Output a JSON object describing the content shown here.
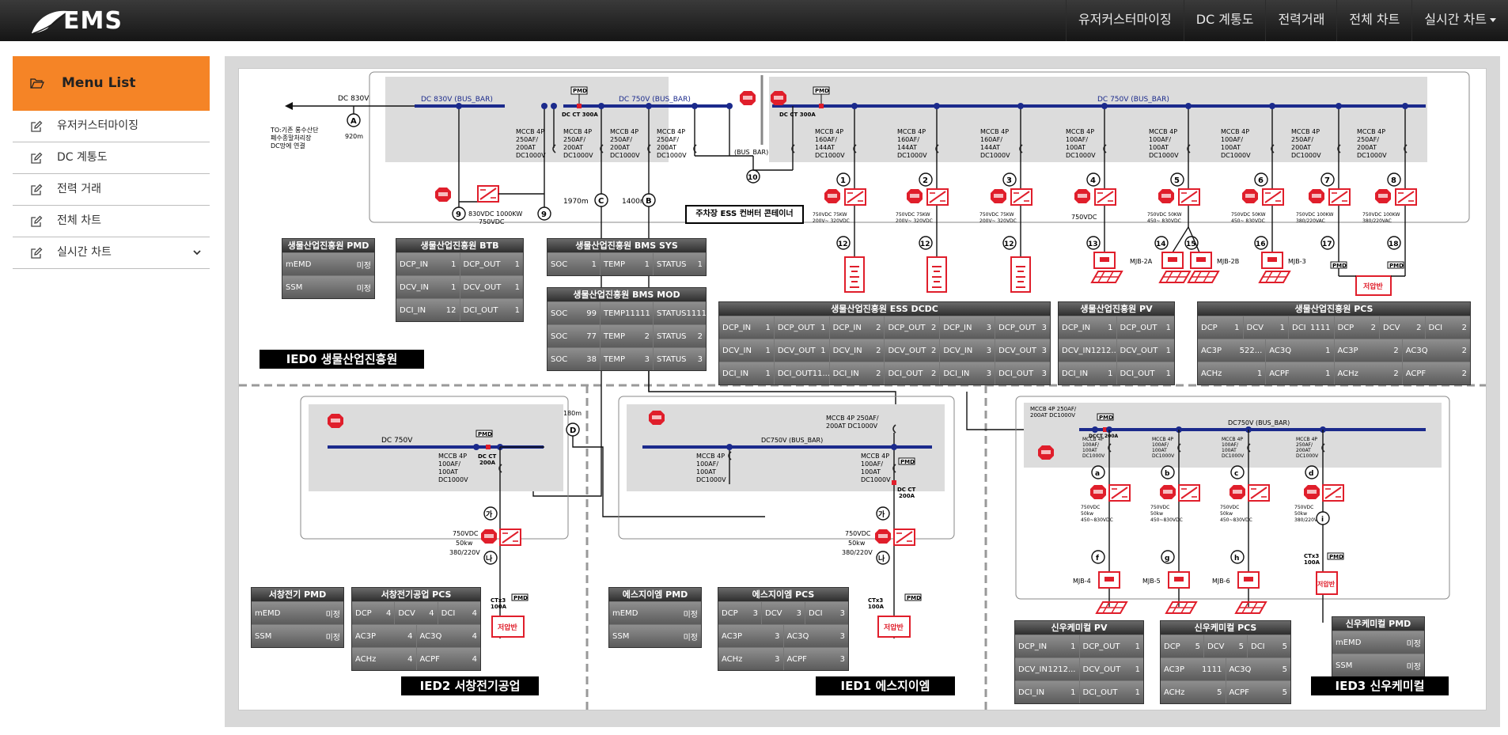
{
  "brand": {
    "logo_text": "EMS"
  },
  "nav": [
    {
      "label": "유저커스터마이징"
    },
    {
      "label": "DC 계통도"
    },
    {
      "label": "전력거래"
    },
    {
      "label": "전체 차트"
    },
    {
      "label": "실시간 차트"
    }
  ],
  "sidebar": {
    "title": "Menu List",
    "items": [
      {
        "label": "유저커스터마이징"
      },
      {
        "label": "DC 계통도"
      },
      {
        "label": "전력 거래"
      },
      {
        "label": "전체 차트"
      },
      {
        "label": "실시간 차트"
      }
    ]
  },
  "colors": {
    "accent": "#f58426",
    "bus": "#1b2a8c",
    "alarm": "#e01e2b",
    "header_bg": "#1f1f1f"
  },
  "diagram": {
    "ied_labels": {
      "ied0": "IED0 생물산업진흥원",
      "ied1": "IED1 에스지이엠",
      "ied2": "IED2 서창전기공업",
      "ied3": "IED3 신우케미컬"
    },
    "ess_box": "주차장 ESS 컨버터 콘테이너",
    "labels": {
      "dc830v": "DC 830V",
      "bus830": "DC 830V (BUS_BAR)",
      "bus750a": "DC 750V (BUS_BAR)",
      "bus750b": "DC 750V (BUS_BAR)",
      "busbar": "(BUS_BAR)",
      "to_line1": "TO:기존 롱수산단",
      "to_line2": "폐수종말처리장",
      "to_line3": "DC망에 연결",
      "dist920": "920m",
      "dist1970": "1970m",
      "dist1400": "1400m",
      "dist180": "180m",
      "conv_btb1": "830VDC 1000KW",
      "conv_btb2": "750VDC",
      "pmd": "PMD",
      "dcct300": "DC CT 300A",
      "dc750_ied2": "DC 750V",
      "dc750_ied1": "DC750V (BUS_BAR)",
      "dc750_ied3": "DC750V (BUS_BAR)",
      "mccb_top_ied1_1": "MCCB 4P 250AF/",
      "mccb_top_ied1_2": "200AT DC1000V",
      "mccb_top_ied3_1": "MCCB 4P 250AF/",
      "mccb_top_ied3_2": "200AT DC1000V",
      "dcct200": "DC CT 200A",
      "dcct200b": "DCCT 200A",
      "ctx3": "CTx3",
      "ct100a": "100A",
      "jeoneap": "저압반",
      "mjb2a": "MJB-2A",
      "mjb2b": "MJB-2B",
      "mjb3": "MJB-3",
      "mjb4": "MJB-4",
      "mjb5": "MJB-5",
      "mjb6": "MJB-6",
      "ied_conv_v": "750VDC",
      "ied_conv_kw": "50kw",
      "ied_conv_ac": "380/220V",
      "ied3_conv1": "750VDC",
      "ied3_conv2": "50kw",
      "ied3_conv3": "450~830VDC",
      "ied3_conv4": "380/220VAC",
      "ess_conv1": "750VDC 75KW",
      "ess_conv2": "200V~ 320VDC",
      "pv_conv": "750VDC",
      "pv_conv1": "750VDC 50KW",
      "pv_conv2": "450~ 830VDC",
      "pcs_conv1": "750VDC 100KW",
      "pcs_conv2": "380/220VAC"
    },
    "mccb_top": [
      [
        "MCCB 4P",
        "250AF/",
        "200AT",
        "DC1000V"
      ],
      [
        "MCCB 4P",
        "250AF/",
        "200AT",
        "DC1000V"
      ],
      [
        "MCCB 4P",
        "250AF/",
        "200AT",
        "DC1000V"
      ],
      [
        "MCCB 4P",
        "250AF/",
        "200AT",
        "DC1000V"
      ]
    ],
    "mccb_right": [
      [
        "MCCB 4P",
        "160AF/",
        "144AT",
        "DC1000V"
      ],
      [
        "MCCB 4P",
        "160AF/",
        "144AT",
        "DC1000V"
      ],
      [
        "MCCB 4P",
        "160AF/",
        "144AT",
        "DC1000V"
      ],
      [
        "MCCB 4P",
        "160AF/",
        "144AT",
        "DC1000V"
      ],
      [
        "MCCB 4P",
        "100AF/",
        "100AT",
        "DC1000V"
      ],
      [
        "MCCB 4P",
        "100AF/",
        "100AT",
        "DC1000V"
      ],
      [
        "MCCB 4P",
        "100AF/",
        "100AT",
        "DC1000V"
      ],
      [
        "MCCB 4P",
        "250AF/",
        "200AT",
        "DC1000V"
      ],
      [
        "MCCB 4P",
        "250AF/",
        "200AT",
        "DC1000V"
      ]
    ],
    "mccb_mid": [
      "MCCB 4P",
      "100AF/",
      "100AT",
      "DC1000V"
    ],
    "markers": {
      "n1": "1",
      "n2": "2",
      "n3": "3",
      "n4": "4",
      "n5": "5",
      "n6": "6",
      "n7": "7",
      "n8": "8",
      "n9": "9",
      "n10": "10",
      "n12": "12",
      "n13": "13",
      "n14": "14",
      "n15": "15",
      "n16": "16",
      "n17": "17",
      "n18": "18",
      "A": "A",
      "B": "B",
      "C": "C",
      "D": "D",
      "ka": "가",
      "na": "나",
      "a": "a",
      "b": "b",
      "c": "c",
      "d": "d",
      "f": "f",
      "g": "g",
      "h": "h",
      "i": "i"
    }
  },
  "tables": {
    "pmd0": {
      "title": "생물산업진흥원 PMD",
      "rows": [
        [
          [
            "mEMD",
            "미정"
          ]
        ],
        [
          [
            "SSM",
            "미정"
          ]
        ]
      ]
    },
    "btb": {
      "title": "생물산업진흥원 BTB",
      "rows": [
        [
          [
            "DCP_IN",
            "1"
          ],
          [
            "DCP_OUT",
            "1"
          ]
        ],
        [
          [
            "DCV_IN",
            "1"
          ],
          [
            "DCV_OUT",
            "1"
          ]
        ],
        [
          [
            "DCI_IN",
            "12"
          ],
          [
            "DCI_OUT",
            "1"
          ]
        ]
      ]
    },
    "bms_sys": {
      "title": "생물산업진흥원 BMS SYS",
      "rows": [
        [
          [
            "SOC",
            "1"
          ],
          [
            "TEMP",
            "1"
          ],
          [
            "STATUS",
            "1"
          ]
        ]
      ]
    },
    "bms_mod": {
      "title": "생물산업진흥원 BMS MOD",
      "rows": [
        [
          [
            "SOC",
            "99"
          ],
          [
            "TEMP",
            "11111"
          ],
          [
            "STATUS",
            "11111"
          ]
        ],
        [
          [
            "SOC",
            "77"
          ],
          [
            "TEMP",
            "2"
          ],
          [
            "STATUS",
            "2"
          ]
        ],
        [
          [
            "SOC",
            "38"
          ],
          [
            "TEMP",
            "3"
          ],
          [
            "STATUS",
            "3"
          ]
        ]
      ]
    },
    "ess_dcdc": {
      "title": "생물산업진흥원 ESS DCDC",
      "rows": [
        [
          [
            "DCP_IN",
            "1"
          ],
          [
            "DCP_OUT",
            "1"
          ],
          [
            "DCP_IN",
            "2"
          ],
          [
            "DCP_OUT",
            "2"
          ],
          [
            "DCP_IN",
            "3"
          ],
          [
            "DCP_OUT",
            "3"
          ]
        ],
        [
          [
            "DCV_IN",
            "1"
          ],
          [
            "DCV_OUT",
            "1"
          ],
          [
            "DCV_IN",
            "2"
          ],
          [
            "DCV_OUT",
            "2"
          ],
          [
            "DCV_IN",
            "3"
          ],
          [
            "DCV_OUT",
            "3"
          ]
        ],
        [
          [
            "DCI_IN",
            "1"
          ],
          [
            "DCI_OUT",
            "11..."
          ],
          [
            "DCI_IN",
            "2"
          ],
          [
            "DCI_OUT",
            "2"
          ],
          [
            "DCI_IN",
            "3"
          ],
          [
            "DCI_OUT",
            "3"
          ]
        ]
      ]
    },
    "pv0": {
      "title": "생물산업진흥원 PV",
      "rows": [
        [
          [
            "DCP_IN",
            "1"
          ],
          [
            "DCP_OUT",
            "1"
          ]
        ],
        [
          [
            "DCV_IN",
            "1212..."
          ],
          [
            "DCV_OUT",
            "1"
          ]
        ],
        [
          [
            "DCI_IN",
            "1"
          ],
          [
            "DCI_OUT",
            "1"
          ]
        ]
      ]
    },
    "pcs0": {
      "title": "생물산업진흥원 PCS",
      "rows": [
        [
          [
            "DCP",
            "1"
          ],
          [
            "DCV",
            "1"
          ],
          [
            "DCI",
            "1111"
          ],
          [
            "DCP",
            "2"
          ],
          [
            "DCV",
            "2"
          ],
          [
            "DCI",
            "2"
          ]
        ],
        [
          [
            "AC3P",
            "522..."
          ],
          [
            "AC3Q",
            "1"
          ],
          [
            "AC3P",
            "2"
          ],
          [
            "AC3Q",
            "2"
          ]
        ],
        [
          [
            "ACHz",
            "1"
          ],
          [
            "ACPF",
            "1"
          ],
          [
            "ACHz",
            "2"
          ],
          [
            "ACPF",
            "2"
          ]
        ]
      ]
    },
    "pmd2": {
      "title": "서창전기 PMD",
      "rows": [
        [
          [
            "mEMD",
            "미정"
          ]
        ],
        [
          [
            "SSM",
            "미정"
          ]
        ]
      ]
    },
    "pcs2": {
      "title": "서창전기공업 PCS",
      "rows": [
        [
          [
            "DCP",
            "4"
          ],
          [
            "DCV",
            "4"
          ],
          [
            "DCI",
            "4"
          ]
        ],
        [
          [
            "AC3P",
            "4"
          ],
          [
            "AC3Q",
            "4"
          ]
        ],
        [
          [
            "ACHz",
            "4"
          ],
          [
            "ACPF",
            "4"
          ]
        ]
      ]
    },
    "pmd1": {
      "title": "에스지이엠 PMD",
      "rows": [
        [
          [
            "mEMD",
            "미정"
          ]
        ],
        [
          [
            "SSM",
            "미정"
          ]
        ]
      ]
    },
    "pcs1": {
      "title": "에스지이엠 PCS",
      "rows": [
        [
          [
            "DCP",
            "3"
          ],
          [
            "DCV",
            "3"
          ],
          [
            "DCI",
            "3"
          ]
        ],
        [
          [
            "AC3P",
            "3"
          ],
          [
            "AC3Q",
            "3"
          ]
        ],
        [
          [
            "ACHz",
            "3"
          ],
          [
            "ACPF",
            "3"
          ]
        ]
      ]
    },
    "pv3": {
      "title": "신우케미컬 PV",
      "rows": [
        [
          [
            "DCP_IN",
            "1"
          ],
          [
            "DCP_OUT",
            "1"
          ]
        ],
        [
          [
            "DCV_IN",
            "1212..."
          ],
          [
            "DCV_OUT",
            "1"
          ]
        ],
        [
          [
            "DCI_IN",
            "1"
          ],
          [
            "DCI_OUT",
            "1"
          ]
        ]
      ]
    },
    "pcs3": {
      "title": "신우케미컬 PCS",
      "rows": [
        [
          [
            "DCP",
            "5"
          ],
          [
            "DCV",
            "5"
          ],
          [
            "DCI",
            "5"
          ]
        ],
        [
          [
            "AC3P",
            "1111"
          ],
          [
            "AC3Q",
            "5"
          ]
        ],
        [
          [
            "ACHz",
            "5"
          ],
          [
            "ACPF",
            "5"
          ]
        ]
      ]
    },
    "pmd3": {
      "title": "신우케미컬 PMD",
      "rows": [
        [
          [
            "mEMD",
            "미정"
          ]
        ],
        [
          [
            "SSM",
            "미정"
          ]
        ]
      ]
    }
  }
}
